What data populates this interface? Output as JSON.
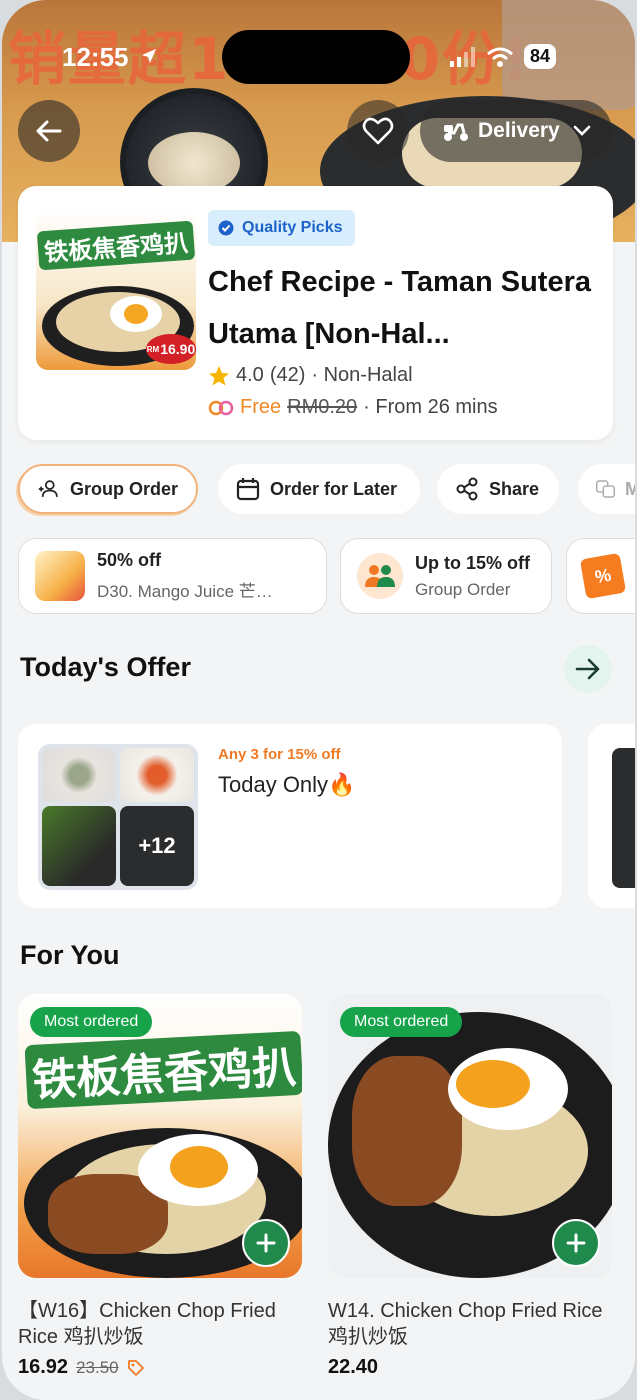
{
  "status_bar": {
    "time": "12:55",
    "battery": "84"
  },
  "hero": {
    "banner_text": "销量超100000份!"
  },
  "top_bar": {
    "delivery_label": "Delivery"
  },
  "merchant": {
    "image_title": "铁板焦香鸡扒",
    "image_price_prefix": "RM",
    "image_price": "16.90",
    "badge": "Quality Picks",
    "name": "Chef Recipe - Taman Sutera Utama [Non-Hal...",
    "rating": "4.0",
    "review_count": "(42)",
    "category": "· Non-Halal",
    "delivery_free": "Free",
    "delivery_old_fee": "RM0.20",
    "delivery_time": "· From 26 mins"
  },
  "actions": {
    "group_order": "Group Order",
    "order_later": "Order for Later",
    "share": "Share",
    "translate": "M"
  },
  "promos": [
    {
      "title": "50% off",
      "subtitle": "D30. Mango Juice 芒…"
    },
    {
      "title": "Up to 15% off",
      "subtitle": "Group Order"
    },
    {
      "tag": "%"
    }
  ],
  "todays_offer": {
    "heading": "Today's Offer",
    "label": "Any 3 for 15% off",
    "title": "Today Only🔥",
    "more_count": "+12"
  },
  "for_you": {
    "heading": "For You",
    "items": [
      {
        "badge": "Most ordered",
        "image_title": "铁板焦香鸡扒",
        "name": "【W16】Chicken Chop Fried Rice 鸡扒炒饭",
        "price": "16.92",
        "old_price": "23.50"
      },
      {
        "badge": "Most ordered",
        "name": "W14. Chicken Chop Fried Rice 鸡扒炒饭",
        "price": "22.40"
      }
    ]
  },
  "colors": {
    "brand_green": "#1f8a4c",
    "badge_green": "#16a34a",
    "orange": "#f07a24",
    "quality_blue": "#1d63c9"
  },
  "icons": [
    "location-arrow-icon",
    "signal-icon",
    "wifi-icon",
    "back-arrow-icon",
    "heart-icon",
    "scooter-icon",
    "chevron-down-icon",
    "verified-icon",
    "star-icon",
    "free-delivery-icon",
    "add-group-icon",
    "calendar-icon",
    "share-icon",
    "translate-icon",
    "arrow-right-icon",
    "tag-icon",
    "plus-icon"
  ]
}
